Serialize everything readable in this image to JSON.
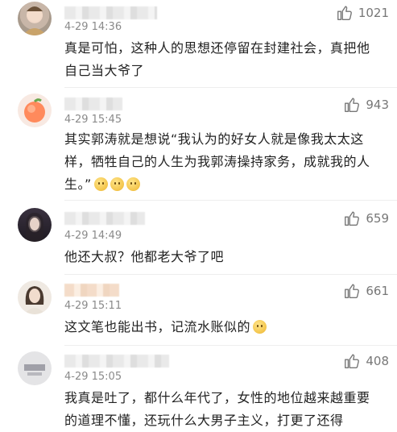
{
  "comments": [
    {
      "time": "4-29 14:36",
      "likes": "1021",
      "text": "真是可怕，这种人的思想还停留在封建社会，真把他自己当大爷了",
      "avatar": "avatar-costume-icon"
    },
    {
      "time": "4-29 15:45",
      "likes": "943",
      "text": "其实郭涛就是想说“我认为的好女人就是像我太太这样，牺牲自己的人生为我郭涛操持家务，成就我的人生。”",
      "avatar": "peach-avatar-icon"
    },
    {
      "time": "4-29 14:49",
      "likes": "659",
      "text": "他还大叔？他都老大爷了吧",
      "avatar": "dark-portrait-avatar-icon"
    },
    {
      "time": "4-29 15:11",
      "likes": "661",
      "text": "这文笔也能出书，记流水账似的",
      "avatar": "woman-portrait-avatar-icon"
    },
    {
      "time": "4-29 15:05",
      "likes": "408",
      "text": "我真是吐了，都什么年代了，女性的地位越来越重要的道理不懂，还玩什么大男子主义，打更了还得",
      "avatar": "gray-text-avatar-icon"
    }
  ],
  "icons": {
    "like": "thumbs-up-icon",
    "emoji_smile": "smile-emoji-icon",
    "emoji_grin": "grin-emoji-icon"
  },
  "colors": {
    "meta_text": "#8a8a8a",
    "body_text": "#222222",
    "like_icon": "#777777"
  }
}
